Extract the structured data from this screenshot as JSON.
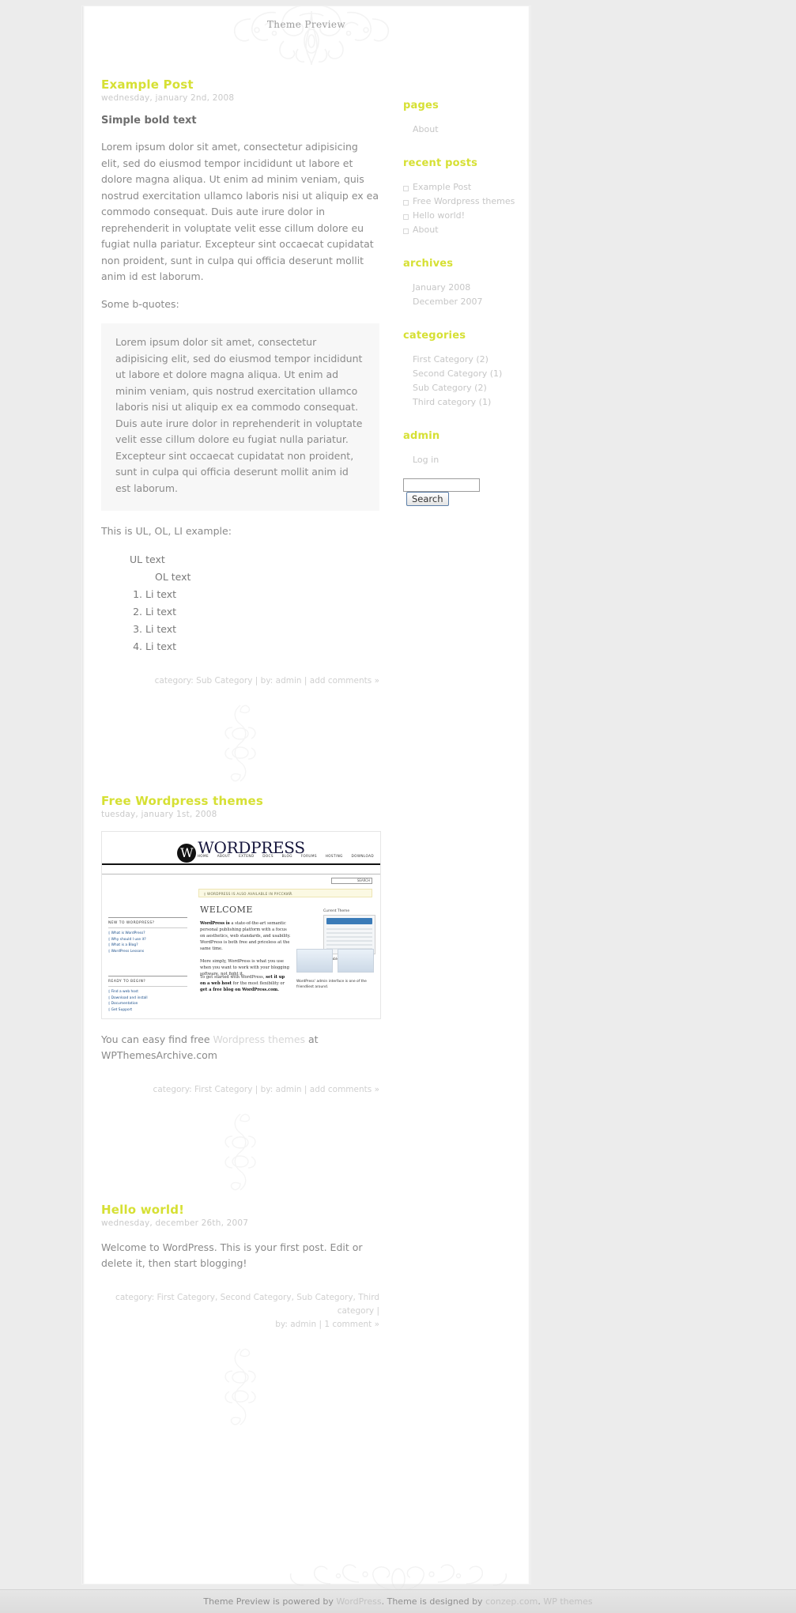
{
  "site": {
    "title": "Theme Preview"
  },
  "posts": [
    {
      "title": "Example Post",
      "date": "wednesday, january 2nd, 2008",
      "heading": "Simple bold text",
      "para1": "Lorem ipsum dolor sit amet, consectetur adipisicing elit, sed do eiusmod tempor incididunt ut labore et dolore magna aliqua. Ut enim ad minim veniam, quis nostrud exercitation ullamco laboris nisi ut aliquip ex ea commodo consequat. Duis aute irure dolor in reprehenderit in voluptate velit esse cillum dolore eu fugiat nulla pariatur. Excepteur sint occaecat cupidatat non proident, sunt in culpa qui officia deserunt mollit anim id est laborum.",
      "quote_intro": "Some b-quotes:",
      "quote": "Lorem ipsum dolor sit amet, consectetur adipisicing elit, sed do eiusmod tempor incididunt ut labore et dolore magna aliqua. Ut enim ad minim veniam, quis nostrud exercitation ullamco laboris nisi ut aliquip ex ea commodo consequat. Duis aute irure dolor in reprehenderit in voluptate velit esse cillum dolore eu fugiat nulla pariatur. Excepteur sint occaecat cupidatat non proident, sunt in culpa qui officia deserunt mollit anim id est laborum.",
      "list_intro": "This is UL, OL, LI example:",
      "ul_text": "UL text",
      "ol_text": "OL text",
      "li_items": [
        "Li text",
        "Li text",
        "Li text",
        "Li text"
      ],
      "meta": "category: Sub Category | by: admin | add comments »"
    },
    {
      "title": "Free Wordpress themes",
      "date": "tuesday, january 1st, 2008",
      "body_before_link": "You can easy find free ",
      "body_link": "Wordpress themes",
      "body_after_link": " at WPThemesArchive.com",
      "meta": "category: First Category | by: admin | add comments »"
    },
    {
      "title": "Hello world!",
      "date": "wednesday, december 26th, 2007",
      "para1": "Welcome to WordPress. This is your first post. Edit or delete it, then start blogging!",
      "meta_line1": "category: First Category, Second Category, Sub Category, Third category |",
      "meta_line2": "by: admin | 1 comment »"
    }
  ],
  "wp_screenshot": {
    "logo_w": "W",
    "logo_text": "WORDPRESS",
    "nav": [
      "HOME",
      "ABOUT",
      "EXTEND",
      "DOCS",
      "BLOG",
      "FORUMS",
      "HOSTING",
      "DOWNLOAD"
    ],
    "search_placeholder": "SEARCH",
    "notice": "◊ WORDPRESS IS ALSO AVAILABLE IN РУССКИЙ.",
    "welcome": "WELCOME",
    "body_bold": "WordPress is",
    "body_rest": " a state-of-the-art semantic personal publishing platform with a focus on aesthetics, web standards, and usability. WordPress is both free and priceless at the same time.",
    "body2": "More simply, WordPress is what you use when you want to work with your blogging software, not fight it.",
    "body3_pre": "To get started with WordPress, ",
    "body3_bold1": "set it up on a web host",
    "body3_mid": " for the most flexibility or ",
    "body3_bold2": "get a free blog on WordPress.com.",
    "left_heading": "NEW TO WORDPRESS?",
    "left_items": [
      "◊ What is WordPress?",
      "◊ Why should I use it?",
      "◊ What is a Blog?",
      "◊ WordPress Lessons"
    ],
    "bot_left_heading": "READY TO BEGIN?",
    "bot_left_items": [
      "◊ Find a web host",
      "◊ Download and install",
      "◊ Documentation",
      "◊ Get Support"
    ],
    "panel_title": "Current Theme",
    "panel_title2": "Available Themes",
    "caption": "WordPress' admin interface is one of the friendliest around."
  },
  "sidebar": {
    "widgets": [
      {
        "title": "pages",
        "style": "plain",
        "items": [
          "About"
        ]
      },
      {
        "title": "recent posts",
        "style": "bulleted",
        "items": [
          "Example Post",
          "Free Wordpress themes",
          "Hello world!",
          "About"
        ]
      },
      {
        "title": "archives",
        "style": "plain",
        "items": [
          "January 2008",
          "December 2007"
        ]
      },
      {
        "title": "categories",
        "style": "plain",
        "items": [
          "First Category (2)",
          "Second Category (1)",
          "Sub Category (2)",
          "Third category (1)"
        ]
      },
      {
        "title": "admin",
        "style": "plain",
        "items": [
          "Log in"
        ]
      }
    ],
    "search": {
      "value": "",
      "placeholder": "",
      "button_label": "Search"
    }
  },
  "footer": {
    "text_1": "Theme Preview is powered by ",
    "link_wordpress": "WordPress",
    "text_2": ". Theme is designed by ",
    "link_conzep": "conzep.com",
    "text_3": ". ",
    "link_wpthemes": "WP themes"
  },
  "colors": {
    "accent": "#d6e034",
    "body_text": "#8a8a8a",
    "muted": "#c6c6c6",
    "page_bg": "#ececec"
  }
}
